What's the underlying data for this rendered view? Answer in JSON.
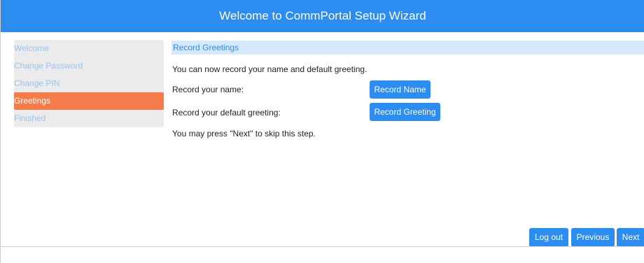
{
  "header": {
    "title": "Welcome to CommPortal Setup Wizard"
  },
  "sidebar": {
    "items": [
      {
        "label": "Welcome"
      },
      {
        "label": "Change Password"
      },
      {
        "label": "Change PIN"
      },
      {
        "label": "Greetings",
        "active": true
      },
      {
        "label": "Finished"
      }
    ]
  },
  "main": {
    "section_title": "Record Greetings",
    "intro": "You can now record your name and default greeting.",
    "name_label": "Record your name:",
    "name_button": "Record Name",
    "greeting_label": "Record your default greeting:",
    "greeting_button": "Record Greeting",
    "skip_note": "You may press \"Next\" to skip this step."
  },
  "footer": {
    "logout": "Log out",
    "previous": "Previous",
    "next": "Next"
  },
  "colors": {
    "header_blue": "#2d8cef",
    "active_orange": "#f67b4a",
    "inactive_link": "#9cc3f0",
    "section_bg": "#d6e8fa"
  }
}
